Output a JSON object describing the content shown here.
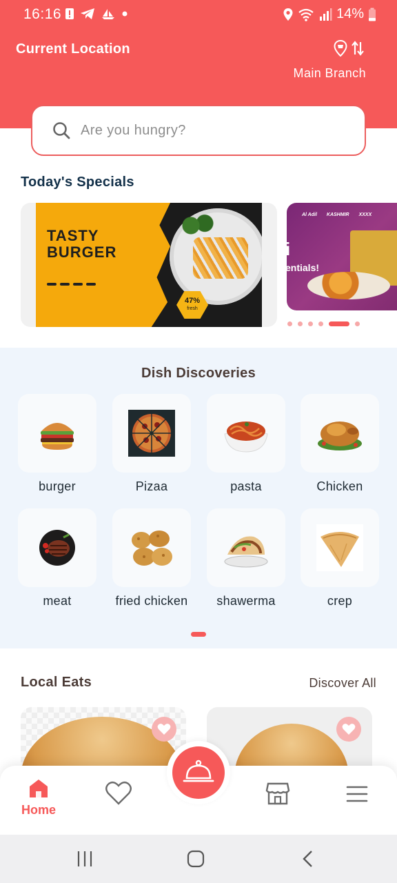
{
  "status_bar": {
    "time": "16:16",
    "battery": "14%"
  },
  "header": {
    "title": "Current Location",
    "branch": "Main Branch"
  },
  "search": {
    "placeholder": "Are you hungry?"
  },
  "specials": {
    "title": "Today's Specials",
    "banner1": {
      "headline_line1": "TASTY",
      "headline_line2": "BURGER",
      "badge_value": "47%",
      "badge_label": "fresh"
    },
    "banner2": {
      "big_text": "i",
      "text": "entials!",
      "brands": [
        "Al Adil",
        "KASHMIR",
        "XXXX"
      ]
    },
    "carousel_total": 6,
    "carousel_active": 5
  },
  "dish_discoveries": {
    "title": "Dish Discoveries",
    "items": [
      {
        "label": "burger",
        "icon": "burger-image"
      },
      {
        "label": "Pizaa",
        "icon": "pizza-image"
      },
      {
        "label": "pasta",
        "icon": "pasta-image"
      },
      {
        "label": "Chicken",
        "icon": "chicken-image"
      },
      {
        "label": "meat",
        "icon": "meat-image"
      },
      {
        "label": "fried chicken",
        "icon": "fried-chicken-image"
      },
      {
        "label": "shawerma",
        "icon": "shawerma-image"
      },
      {
        "label": "crep",
        "icon": "crep-image"
      }
    ]
  },
  "local_eats": {
    "title": "Local Eats",
    "discover_all": "Discover All"
  },
  "bottom_nav": {
    "home": "Home"
  },
  "colors": {
    "accent": "#f65959",
    "dish_bg": "#eff5fc",
    "heading": "#123049"
  }
}
